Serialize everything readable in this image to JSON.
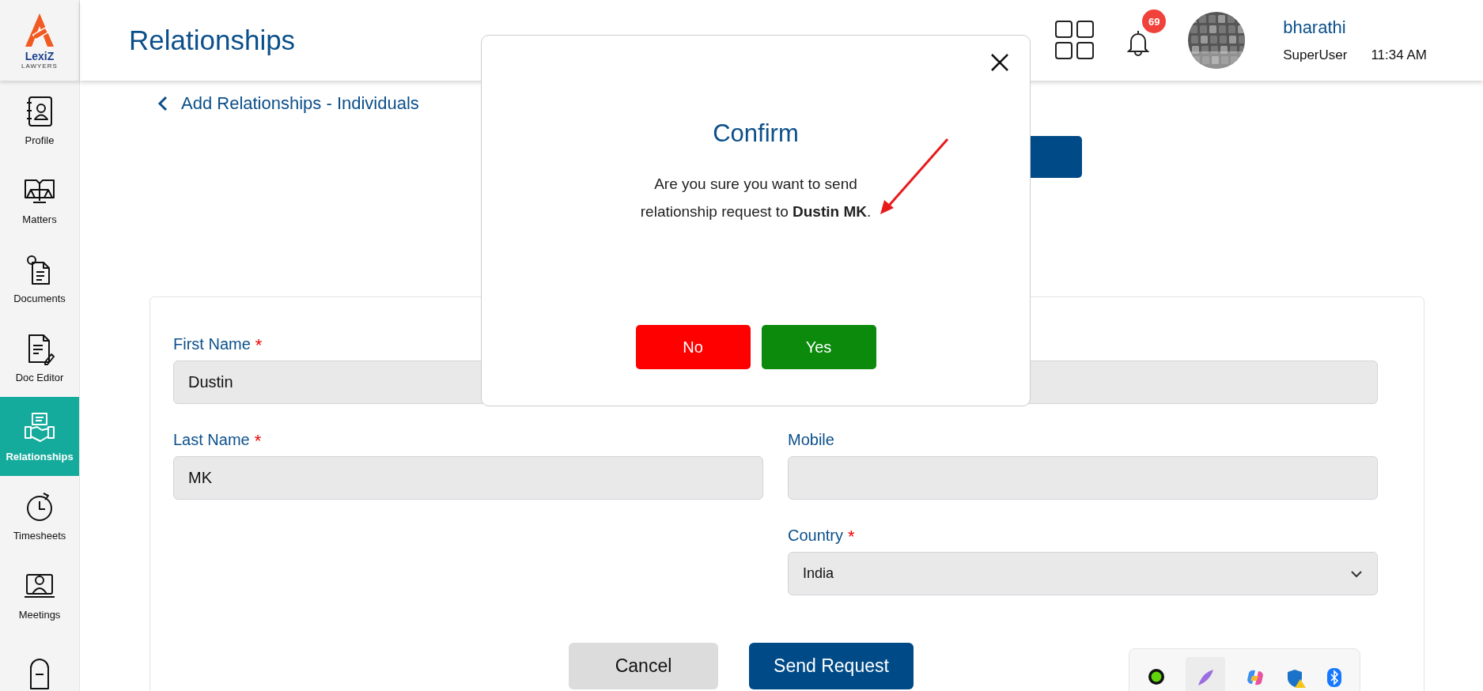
{
  "sidebar": {
    "logo": {
      "name": "LexiZ",
      "tagline": "LAWYERS"
    },
    "items": [
      {
        "label": "Profile",
        "selected": false
      },
      {
        "label": "Matters",
        "selected": false
      },
      {
        "label": "Documents",
        "selected": false
      },
      {
        "label": "Doc Editor",
        "selected": false
      },
      {
        "label": "Relationships",
        "selected": true
      },
      {
        "label": "Timesheets",
        "selected": false
      },
      {
        "label": "Meetings",
        "selected": false
      },
      {
        "selected": false
      }
    ]
  },
  "header": {
    "title": "Relationships",
    "notifications_count": "69",
    "user_name": "bharathi",
    "user_role": "SuperUser",
    "time": "11:34 AM"
  },
  "page": {
    "back_link": "Add Relationships - Individuals"
  },
  "form": {
    "first_name": {
      "label": "First Name",
      "required_mark": "*",
      "value": "Dustin"
    },
    "last_name": {
      "label": "Last Name",
      "required_mark": "*",
      "value": "MK"
    },
    "mobile": {
      "label": "Mobile"
    },
    "country": {
      "label": "Country",
      "required_mark": "*",
      "value": "India"
    },
    "buttons": [
      {
        "label": "Cancel",
        "kind": "secondary"
      },
      {
        "label": "Send Request",
        "kind": "primary"
      }
    ]
  },
  "dialog": {
    "title": "Confirm",
    "message": "Are you sure you want to send relationship request to **Dustin MK**.",
    "buttons": [
      {
        "label": "No",
        "kind": "danger"
      },
      {
        "label": "Yes",
        "kind": "success"
      }
    ]
  }
}
